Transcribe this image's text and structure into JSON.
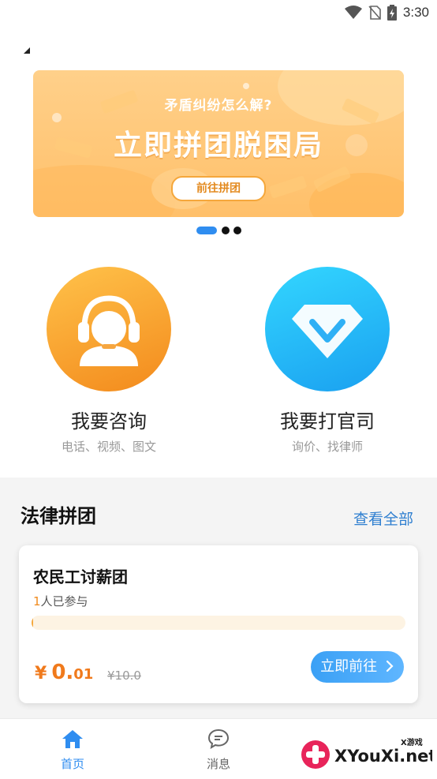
{
  "status_bar": {
    "time": "3:30"
  },
  "banner": {
    "subtitle": "矛盾纠纷怎么解?",
    "title": "立即拼团脱困局",
    "button": "前往拼团"
  },
  "entries": [
    {
      "title": "我要咨询",
      "subtitle": "电话、视频、图文"
    },
    {
      "title": "我要打官司",
      "subtitle": "询价、找律师"
    }
  ],
  "section": {
    "title": "法律拼团",
    "view_all": "查看全部"
  },
  "card": {
    "title": "农民工讨薪团",
    "joined_count": "1",
    "joined_suffix": "人已参与",
    "progress": 0.005,
    "price_symbol": "¥",
    "price_int": "0.",
    "price_dec": "01",
    "original_price": "¥10.0",
    "button": "立即前往"
  },
  "tabbar": {
    "items": [
      {
        "label": "首页",
        "active": true
      },
      {
        "label": "消息",
        "active": false
      }
    ]
  },
  "watermark": {
    "brand": "XYouXi.net",
    "tag": "X游戏"
  },
  "colors": {
    "accent": "#2f8df0",
    "orange": "#f07a1c"
  }
}
